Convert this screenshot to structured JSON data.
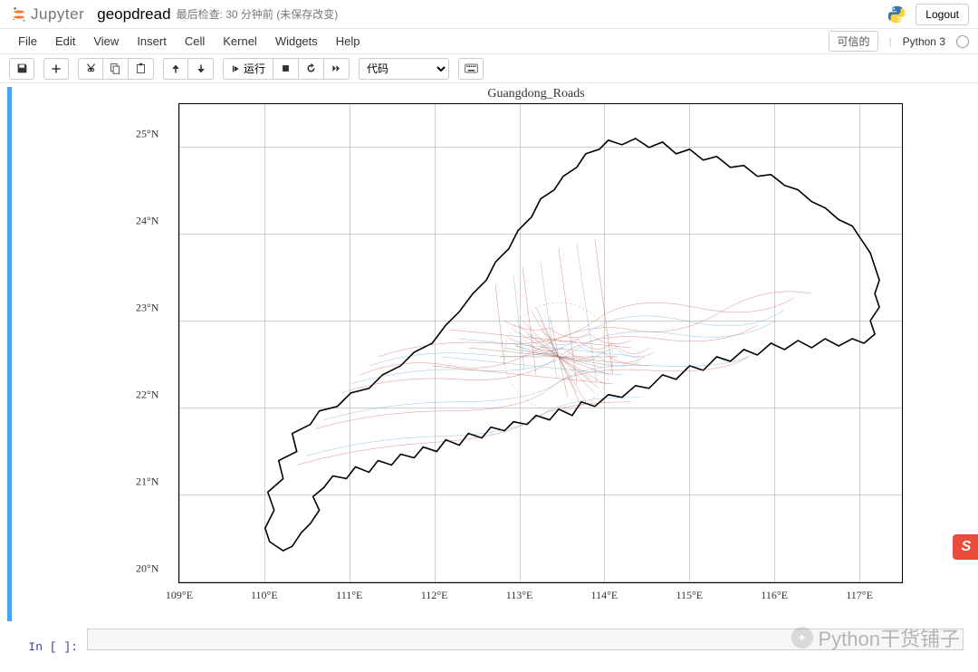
{
  "header": {
    "logo_text": "Jupyter",
    "notebook_name": "geopdread",
    "checkpoint": "最后检查: 30 分钟前 (未保存改变)",
    "logout": "Logout"
  },
  "menubar": {
    "items": [
      "File",
      "Edit",
      "View",
      "Insert",
      "Cell",
      "Kernel",
      "Widgets",
      "Help"
    ],
    "trusted": "可信的",
    "kernel": "Python 3"
  },
  "toolbar": {
    "run_label": "运行",
    "cell_type": "代码"
  },
  "chart_data": {
    "type": "map",
    "title": "Guangdong_Roads",
    "xlabel": "",
    "ylabel": "",
    "x_ticks": [
      "109°E",
      "110°E",
      "111°E",
      "112°E",
      "113°E",
      "114°E",
      "115°E",
      "116°E",
      "117°E"
    ],
    "y_ticks": [
      "20°N",
      "21°N",
      "22°N",
      "23°N",
      "24°N",
      "25°N"
    ],
    "xlim": [
      109,
      117.5
    ],
    "ylim": [
      20,
      25.5
    ],
    "description": "Road network map of Guangdong Province, China. Province boundary in black outline. Dense network of roads shown as thin red and blue lines. Highest density around Pearl River Delta (approximately 113°E, 23°N). Internal grid lines at 1 degree intervals."
  },
  "input_cell": {
    "prompt": "In [ ]:",
    "content": ""
  },
  "watermark": "Python干货铺子",
  "side_badge": "S"
}
